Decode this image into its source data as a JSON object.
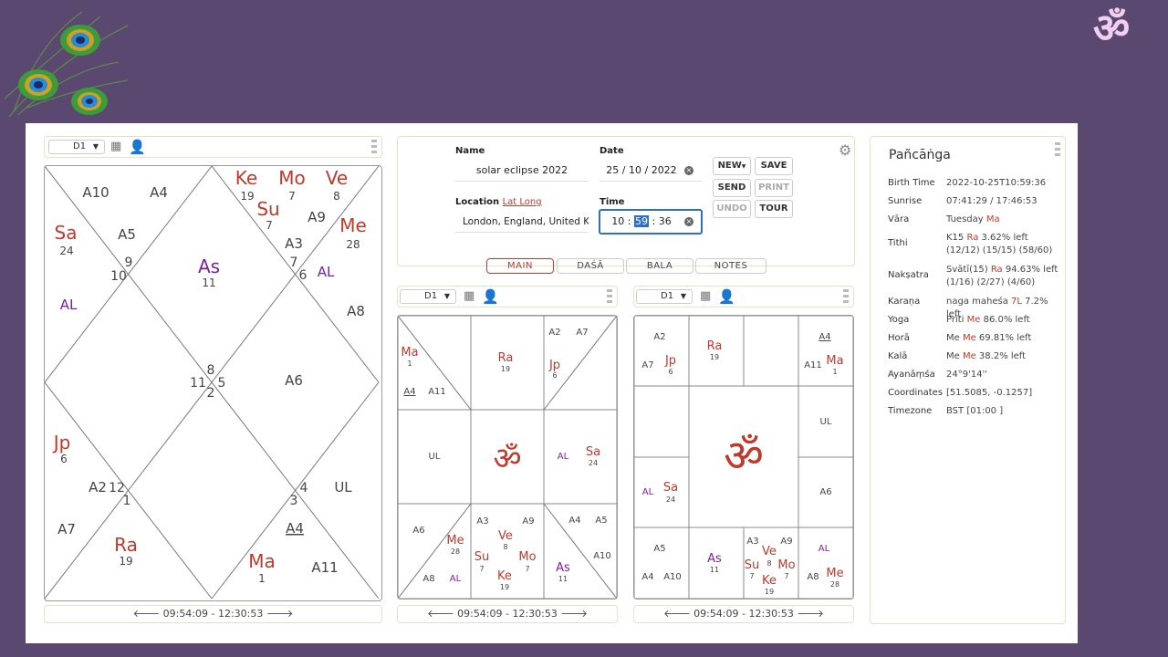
{
  "header": {
    "om_symbol": "ॐ"
  },
  "left_chart": {
    "division": "D1",
    "time_range": "09:54:09 - 12:30:53"
  },
  "form": {
    "name_label": "Name",
    "name_value": "solar eclipse 2022",
    "date_label": "Date",
    "date_value": "25 / 10 / 2022",
    "location_label": "Location",
    "latlong_link": "Lat Long",
    "location_value": "London, England, United Kin",
    "time_label": "Time",
    "time_hh": "10",
    "time_mm": "59",
    "time_ss": "36",
    "buttons": {
      "new": "NEW",
      "save": "SAVE",
      "send": "SEND",
      "print": "PRINT",
      "undo": "UNDO",
      "tour": "TOUR"
    },
    "tabs": [
      "MAIN",
      "DAŚĀ",
      "BALA",
      "NOTES"
    ]
  },
  "mid_chart": {
    "division": "D1",
    "time_range": "09:54:09 - 12:30:53"
  },
  "right_chart": {
    "division": "D1",
    "time_range": "09:54:09 - 12:30:53"
  },
  "panchanga": {
    "title": "Pañcāṅga",
    "rows": [
      {
        "key": "Birth Time",
        "v1": "2022-10-25T10:59:36",
        "v2": ""
      },
      {
        "key": "Sunrise",
        "v1": "07:41:29 / 17:46:53",
        "v2": ""
      },
      {
        "key": "Vāra",
        "v1": "Tuesday ",
        "red": "Ma",
        "v2": ""
      },
      {
        "key": "Tithi",
        "v1": "K15 ",
        "red": "Ra",
        "v1b": " 3.62% left",
        "v2": "(12/12) (15/15) (58/60)"
      },
      {
        "key": "Nakṣatra",
        "v1": "Svātī(15) ",
        "red": "Ra",
        "v1b": " 94.63% left",
        "v2": "(1/16) (2/27) (4/60)"
      },
      {
        "key": "Karaṇa",
        "v1": "naga maheśa ",
        "red": "7L",
        "v1b": " 7.2% left",
        "v2": ""
      },
      {
        "key": "Yoga",
        "v1": "Prīti ",
        "red": "Me",
        "v1b": " 86.0% left",
        "v2": ""
      },
      {
        "key": "Horā",
        "v1": "Me ",
        "red": "Me",
        "v1b": " 69.81% left",
        "v2": ""
      },
      {
        "key": "Kalā",
        "v1": "Me ",
        "red": "Me",
        "v1b": " 38.2% left",
        "v2": ""
      },
      {
        "key": "Ayanāṃśa",
        "v1": "24°9'14''",
        "v2": ""
      },
      {
        "key": "Coordinates",
        "v1": "[51.5085, -0.1257]",
        "v2": ""
      },
      {
        "key": "Timezone",
        "v1": "BST [01:00 ]",
        "v2": ""
      }
    ]
  },
  "colors": {
    "planet": "#c0392b",
    "arudha": "#555555",
    "special": "#7b1fa2",
    "ascendant": "#7b1fa2"
  },
  "north_chart_labels": [
    {
      "t": "Ke",
      "c": "planet"
    },
    {
      "t": "19",
      "c": "deg"
    },
    {
      "t": "Mo",
      "c": "planet"
    },
    {
      "t": "7",
      "c": "deg"
    },
    {
      "t": "Ve",
      "c": "planet"
    },
    {
      "t": "8",
      "c": "deg"
    },
    {
      "t": "Su",
      "c": "planet"
    },
    {
      "t": "7",
      "c": "deg"
    },
    {
      "t": "A9",
      "c": "arudha"
    },
    {
      "t": "Me",
      "c": "planet"
    },
    {
      "t": "28",
      "c": "deg"
    },
    {
      "t": "A10",
      "c": "arudha"
    },
    {
      "t": "A4",
      "c": "arudha"
    },
    {
      "t": "Sa",
      "c": "planet"
    },
    {
      "t": "24",
      "c": "deg"
    },
    {
      "t": "A5",
      "c": "arudha"
    },
    {
      "t": "A3",
      "c": "arudha"
    },
    {
      "t": "AL",
      "c": "special"
    },
    {
      "t": "As",
      "c": "ascendant"
    },
    {
      "t": "11",
      "c": "deg"
    },
    {
      "t": "AL",
      "c": "special"
    },
    {
      "t": "A8",
      "c": "arudha"
    },
    {
      "t": "A6",
      "c": "arudha"
    },
    {
      "t": "Jp",
      "c": "planet"
    },
    {
      "t": "6",
      "c": "deg"
    },
    {
      "t": "A2",
      "c": "arudha"
    },
    {
      "t": "UL",
      "c": "arudha"
    },
    {
      "t": "A7",
      "c": "arudha"
    },
    {
      "t": "A4",
      "c": "arudha"
    },
    {
      "t": "Ra",
      "c": "planet"
    },
    {
      "t": "19",
      "c": "deg"
    },
    {
      "t": "Ma",
      "c": "planet"
    },
    {
      "t": "1",
      "c": "deg"
    },
    {
      "t": "A11",
      "c": "arudha"
    },
    {
      "t": "9",
      "c": "sign"
    },
    {
      "t": "10",
      "c": "sign"
    },
    {
      "t": "7",
      "c": "sign"
    },
    {
      "t": "6",
      "c": "sign"
    },
    {
      "t": "8",
      "c": "sign"
    },
    {
      "t": "11",
      "c": "sign"
    },
    {
      "t": "5",
      "c": "sign"
    },
    {
      "t": "2",
      "c": "sign"
    },
    {
      "t": "12",
      "c": "sign"
    },
    {
      "t": "1",
      "c": "sign"
    },
    {
      "t": "4",
      "c": "sign"
    },
    {
      "t": "3",
      "c": "sign"
    }
  ],
  "east_chart_labels": [
    {
      "t": "Ma",
      "c": "planet"
    },
    {
      "t": "1",
      "c": "deg"
    },
    {
      "t": "A4",
      "c": "arudha"
    },
    {
      "t": "A11",
      "c": "arudha"
    },
    {
      "t": "Ra",
      "c": "planet"
    },
    {
      "t": "19",
      "c": "deg"
    },
    {
      "t": "A2",
      "c": "arudha"
    },
    {
      "t": "A7",
      "c": "arudha"
    },
    {
      "t": "Jp",
      "c": "planet"
    },
    {
      "t": "6",
      "c": "deg"
    },
    {
      "t": "UL",
      "c": "arudha"
    },
    {
      "t": "AL",
      "c": "special"
    },
    {
      "t": "Sa",
      "c": "planet"
    },
    {
      "t": "24",
      "c": "deg"
    },
    {
      "t": "A6",
      "c": "arudha"
    },
    {
      "t": "Me",
      "c": "planet"
    },
    {
      "t": "28",
      "c": "deg"
    },
    {
      "t": "A8",
      "c": "arudha"
    },
    {
      "t": "AL",
      "c": "special"
    },
    {
      "t": "A3",
      "c": "arudha"
    },
    {
      "t": "A9",
      "c": "arudha"
    },
    {
      "t": "Ve",
      "c": "planet"
    },
    {
      "t": "8",
      "c": "deg"
    },
    {
      "t": "Su",
      "c": "planet"
    },
    {
      "t": "7",
      "c": "deg"
    },
    {
      "t": "Mo",
      "c": "planet"
    },
    {
      "t": "7",
      "c": "deg"
    },
    {
      "t": "Ke",
      "c": "planet"
    },
    {
      "t": "19",
      "c": "deg"
    },
    {
      "t": "A4",
      "c": "arudha"
    },
    {
      "t": "A5",
      "c": "arudha"
    },
    {
      "t": "A10",
      "c": "arudha"
    },
    {
      "t": "As",
      "c": "ascendant"
    },
    {
      "t": "11",
      "c": "deg"
    }
  ],
  "south_chart_labels": [
    {
      "t": "A2",
      "c": "arudha"
    },
    {
      "t": "A7",
      "c": "arudha"
    },
    {
      "t": "Jp",
      "c": "planet"
    },
    {
      "t": "6",
      "c": "deg"
    },
    {
      "t": "Ra",
      "c": "planet"
    },
    {
      "t": "19",
      "c": "deg"
    },
    {
      "t": "A4",
      "c": "arudha"
    },
    {
      "t": "A11",
      "c": "arudha"
    },
    {
      "t": "Ma",
      "c": "planet"
    },
    {
      "t": "1",
      "c": "deg"
    },
    {
      "t": "UL",
      "c": "arudha"
    },
    {
      "t": "AL",
      "c": "special"
    },
    {
      "t": "Sa",
      "c": "planet"
    },
    {
      "t": "24",
      "c": "deg"
    },
    {
      "t": "A6",
      "c": "arudha"
    },
    {
      "t": "A5",
      "c": "arudha"
    },
    {
      "t": "A4",
      "c": "arudha"
    },
    {
      "t": "A10",
      "c": "arudha"
    },
    {
      "t": "As",
      "c": "ascendant"
    },
    {
      "t": "11",
      "c": "deg"
    },
    {
      "t": "A3",
      "c": "arudha"
    },
    {
      "t": "A9",
      "c": "arudha"
    },
    {
      "t": "Ve",
      "c": "planet"
    },
    {
      "t": "8",
      "c": "deg"
    },
    {
      "t": "Su",
      "c": "planet"
    },
    {
      "t": "7",
      "c": "deg"
    },
    {
      "t": "Mo",
      "c": "planet"
    },
    {
      "t": "7",
      "c": "deg"
    },
    {
      "t": "Ke",
      "c": "planet"
    },
    {
      "t": "19",
      "c": "deg"
    },
    {
      "t": "AL",
      "c": "special"
    },
    {
      "t": "A8",
      "c": "arudha"
    },
    {
      "t": "Me",
      "c": "planet"
    },
    {
      "t": "28",
      "c": "deg"
    }
  ]
}
